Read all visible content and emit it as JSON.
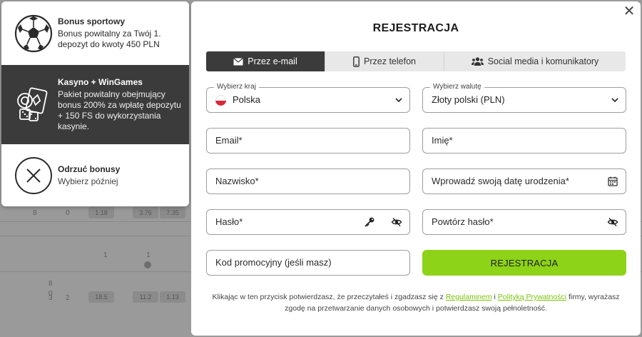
{
  "background": {
    "rows": [
      {
        "cells": [
          "8",
          "0"
        ],
        "odds": [
          "1.18",
          "3.76",
          "7.35"
        ]
      },
      {
        "cells": [
          "1",
          "1"
        ],
        "odds": []
      },
      {
        "cells": [
          "8",
          "0"
        ],
        "odds": []
      },
      {
        "cells": [
          "3",
          "2"
        ],
        "odds": [
          "18.5",
          "11.2",
          "1.13"
        ]
      }
    ]
  },
  "bonuses": [
    {
      "title": "Bonus sportowy",
      "desc": "Bonus powitalny za Twój 1. depozyt do kwoty 450 PLN",
      "icon": "soccer-ball-icon"
    },
    {
      "title": "Kasyno + WinGames",
      "desc": "Pakiet powitalny obejmujący bonus 200% za wpłatę depozytu + 150 FS do wykorzystania kasynie.",
      "icon": "casino-chips-icon"
    },
    {
      "title": "Odrzuć bonusy",
      "desc": "Wybierz później",
      "icon": "decline-x-icon"
    }
  ],
  "modal": {
    "title": "REJESTRACJA",
    "close": "✕",
    "tabs": [
      {
        "label": "Przez e-mail",
        "icon": "envelope-icon",
        "active": true
      },
      {
        "label": "Przez telefon",
        "icon": "phone-icon",
        "active": false
      },
      {
        "label": "Social media i komunikatory",
        "icon": "users-icon",
        "active": false
      }
    ],
    "country": {
      "label": "Wybierz kraj",
      "value": "Polska"
    },
    "currency": {
      "label": "Wybierz walutę",
      "value": "Złoty polski (PLN)"
    },
    "email": {
      "placeholder": "Email*"
    },
    "first_name": {
      "placeholder": "Imię*"
    },
    "last_name": {
      "placeholder": "Nazwisko*"
    },
    "birth_date": {
      "placeholder": "Wprowadź swoją datę urodzenia*"
    },
    "password": {
      "placeholder": "Hasło*"
    },
    "password_repeat": {
      "placeholder": "Powtórz hasło*"
    },
    "promo": {
      "placeholder": "Kod promocyjny (jeśli masz)"
    },
    "submit": "REJESTRACJA",
    "terms": {
      "before": "Klikając w ten przycisk potwierdzasz, że przeczytałeś i zgadzasz się z ",
      "link1": "Regulaminem",
      "mid": " i ",
      "link2": "Polityką Prywatności",
      "after": " firmy, wyrażasz zgodę na przetwarzanie danych osobowych i potwierdzasz swoją pełnoletność."
    }
  },
  "colors": {
    "accent": "#8dd317",
    "dark": "#3b3b3b",
    "link": "#7cc20c",
    "flag_red": "#d8283a"
  }
}
